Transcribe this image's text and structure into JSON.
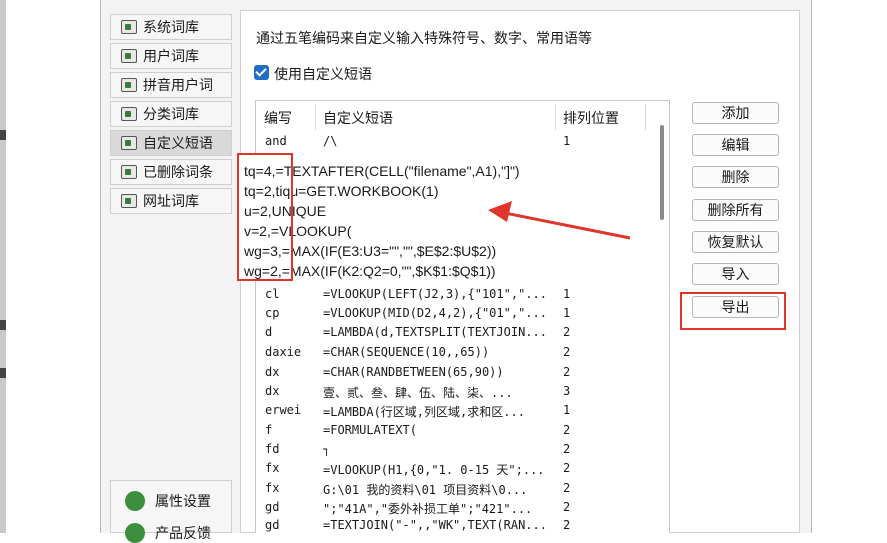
{
  "sidebar": {
    "items": [
      {
        "label": "系统词库",
        "active": false
      },
      {
        "label": "用户词库",
        "active": false
      },
      {
        "label": "拼音用户词",
        "active": false
      },
      {
        "label": "分类词库",
        "active": false
      },
      {
        "label": "自定义短语",
        "active": true
      },
      {
        "label": "已删除词条",
        "active": false
      },
      {
        "label": "网址词库",
        "active": false
      }
    ],
    "bottom": [
      {
        "label": "属性设置"
      },
      {
        "label": "产品反馈"
      }
    ]
  },
  "main": {
    "description": "通过五笔编码来自定义输入特殊符号、数字、常用语等",
    "checkbox_label": "使用自定义短语",
    "checkbox_checked": true,
    "columns": [
      "编写",
      "自定义短语",
      "排列位置"
    ],
    "rows": [
      {
        "code": "and",
        "phrase": "/\\",
        "pos": "1"
      },
      {
        "code": "cl",
        "phrase": "=VLOOKUP(LEFT(J2,3),{\"101\",\"...",
        "pos": "1"
      },
      {
        "code": "cp",
        "phrase": "=VLOOKUP(MID(D2,4,2),{\"01\",\"...",
        "pos": "1"
      },
      {
        "code": "d",
        "phrase": "=LAMBDA(d,TEXTSPLIT(TEXTJOIN...",
        "pos": "2"
      },
      {
        "code": "daxie",
        "phrase": "=CHAR(SEQUENCE(10,,65))",
        "pos": "2"
      },
      {
        "code": "dx",
        "phrase": "=CHAR(RANDBETWEEN(65,90))",
        "pos": "2"
      },
      {
        "code": "dx",
        "phrase": "壹、贰、叁、肆、伍、陆、柒、...",
        "pos": "3"
      },
      {
        "code": "erwei",
        "phrase": "=LAMBDA(行区域,列区域,求和区...",
        "pos": "1"
      },
      {
        "code": "f",
        "phrase": "=FORMULATEXT(",
        "pos": "2"
      },
      {
        "code": "fd",
        "phrase": "┐",
        "pos": "2"
      },
      {
        "code": "fx",
        "phrase": "=VLOOKUP(H1,{0,\"1. 0-15 天\";...",
        "pos": "2"
      },
      {
        "code": "fx",
        "phrase": "G:\\01 我的资料\\01 项目资料\\0...",
        "pos": "2"
      },
      {
        "code": "gd",
        "phrase": "\";\"41A\",\"委外补损工单\";\"421\"...",
        "pos": "2"
      },
      {
        "code": "gd",
        "phrase": "=TEXTJOIN(\"-\",,\"WK\",TEXT(RAN...",
        "pos": "2"
      }
    ]
  },
  "buttons": {
    "add": "添加",
    "edit": "编辑",
    "delete": "删除",
    "delete_all": "删除所有",
    "restore_default": "恢复默认",
    "import": "导入",
    "export": "导出"
  },
  "annotation": {
    "lines": [
      "tq=4,=TEXTAFTER(CELL(\"filename\",A1),\"]\")",
      "tq=2,tiqu=GET.WORKBOOK(1)",
      "u=2,UNIQUE",
      "v=2,=VLOOKUP(",
      "wg=3,=MAX(IF(E3:U3=\"\",\"\",$E$2:$U$2))",
      "wg=2,=MAX(IF(K2:Q2=0,\"\",$K$1:$Q$1))"
    ],
    "highlight_color": "#e0352b"
  }
}
